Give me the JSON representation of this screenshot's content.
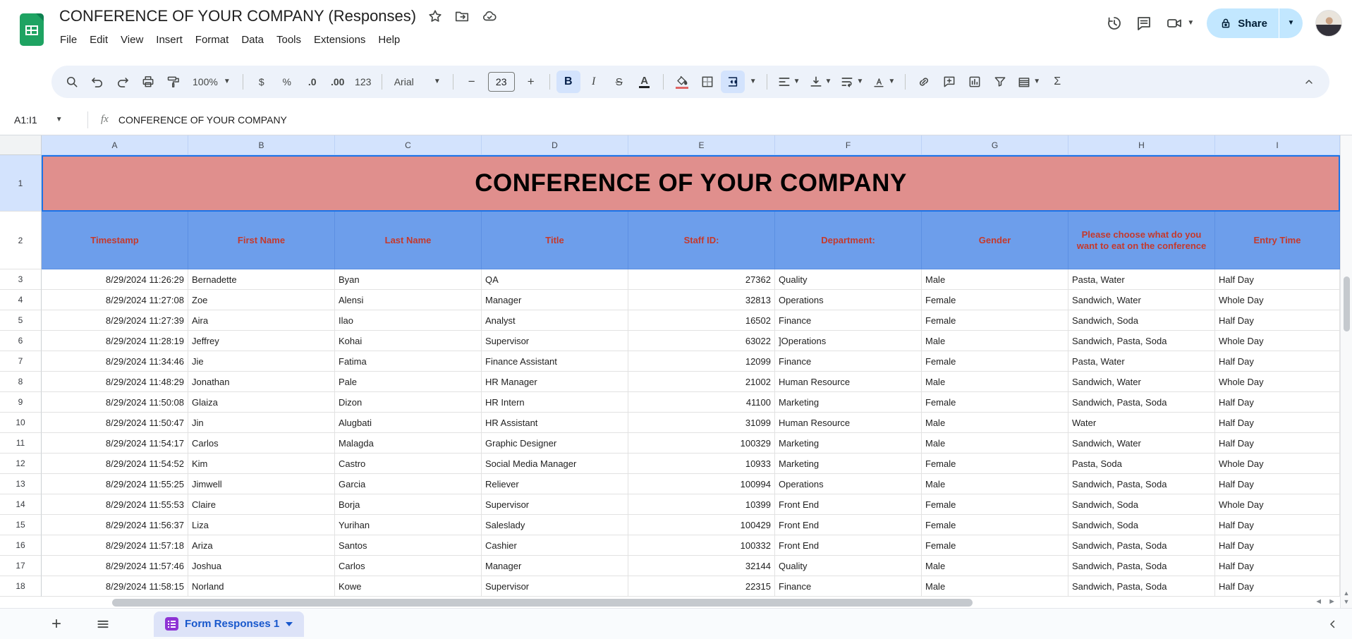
{
  "app": {
    "title": "CONFERENCE OF YOUR COMPANY (Responses)",
    "menus": [
      "File",
      "Edit",
      "View",
      "Insert",
      "Format",
      "Data",
      "Tools",
      "Extensions",
      "Help"
    ],
    "share_label": "Share"
  },
  "toolbar": {
    "zoom_value": "100%",
    "currency": "$",
    "percent": "%",
    "decrease_decimal": ".0",
    "increase_decimal": ".00",
    "more_formats": "123",
    "font_family": "Arial",
    "font_size": "23",
    "minus": "−",
    "plus": "+",
    "bold": "B",
    "italic": "I",
    "strikethrough": "S",
    "text_color": "A",
    "functions": "Σ"
  },
  "formula_bar": {
    "name_box": "A1:I1",
    "fx_label": "fx",
    "value": "CONFERENCE OF YOUR COMPANY"
  },
  "grid": {
    "column_letters": [
      "A",
      "B",
      "C",
      "D",
      "E",
      "F",
      "G",
      "H",
      "I"
    ],
    "title_row": {
      "number": "1",
      "text": "CONFERENCE OF YOUR COMPANY"
    },
    "header_row": {
      "number": "2",
      "cells": [
        "Timestamp",
        "First Name",
        "Last Name",
        "Title",
        "Staff ID:",
        "Department:",
        "Gender",
        "Please choose what do you want to eat on the conference",
        "Entry Time"
      ]
    },
    "rows": [
      {
        "number": "3",
        "cells": [
          "8/29/2024 11:26:29",
          "Bernadette",
          "Byan",
          "QA",
          "27362",
          "Quality",
          "Male",
          "Pasta, Water",
          "Half Day"
        ]
      },
      {
        "number": "4",
        "cells": [
          "8/29/2024 11:27:08",
          "Zoe",
          "Alensi",
          "Manager",
          "32813",
          "Operations",
          "Female",
          "Sandwich, Water",
          "Whole Day"
        ]
      },
      {
        "number": "5",
        "cells": [
          "8/29/2024 11:27:39",
          "Aira",
          "Ilao",
          "Analyst",
          "16502",
          "Finance",
          "Female",
          "Sandwich, Soda",
          "Half Day"
        ]
      },
      {
        "number": "6",
        "cells": [
          "8/29/2024 11:28:19",
          "Jeffrey",
          "Kohai",
          "Supervisor",
          "63022",
          "]Operations",
          "Male",
          "Sandwich, Pasta, Soda",
          "Whole Day"
        ]
      },
      {
        "number": "7",
        "cells": [
          "8/29/2024 11:34:46",
          "Jie",
          "Fatima",
          "Finance Assistant",
          "12099",
          "Finance",
          "Female",
          "Pasta, Water",
          "Half Day"
        ]
      },
      {
        "number": "8",
        "cells": [
          "8/29/2024 11:48:29",
          "Jonathan",
          "Pale",
          "HR Manager",
          "21002",
          "Human Resource",
          "Male",
          "Sandwich, Water",
          "Whole Day"
        ]
      },
      {
        "number": "9",
        "cells": [
          "8/29/2024 11:50:08",
          "Glaiza",
          "Dizon",
          "HR Intern",
          "41100",
          "Marketing",
          "Female",
          "Sandwich, Pasta, Soda",
          "Half Day"
        ]
      },
      {
        "number": "10",
        "cells": [
          "8/29/2024 11:50:47",
          "Jin",
          "Alugbati",
          "HR Assistant",
          "31099",
          "Human Resource",
          "Male",
          "Water",
          "Half Day"
        ]
      },
      {
        "number": "11",
        "cells": [
          "8/29/2024 11:54:17",
          "Carlos",
          "Malagda",
          "Graphic Designer",
          "100329",
          "Marketing",
          "Male",
          "Sandwich, Water",
          "Half Day"
        ]
      },
      {
        "number": "12",
        "cells": [
          "8/29/2024 11:54:52",
          "Kim",
          "Castro",
          "Social Media Manager",
          "10933",
          "Marketing",
          "Female",
          "Pasta, Soda",
          "Whole Day"
        ]
      },
      {
        "number": "13",
        "cells": [
          "8/29/2024 11:55:25",
          "Jimwell",
          "Garcia",
          "Reliever",
          "100994",
          "Operations",
          "Male",
          "Sandwich, Pasta, Soda",
          "Half Day"
        ]
      },
      {
        "number": "14",
        "cells": [
          "8/29/2024 11:55:53",
          "Claire",
          "Borja",
          "Supervisor",
          "10399",
          "Front End",
          "Female",
          "Sandwich, Soda",
          "Whole Day"
        ]
      },
      {
        "number": "15",
        "cells": [
          "8/29/2024 11:56:37",
          "Liza",
          "Yurihan",
          "Saleslady",
          "100429",
          "Front End",
          "Female",
          "Sandwich, Soda",
          "Half Day"
        ]
      },
      {
        "number": "16",
        "cells": [
          "8/29/2024 11:57:18",
          "Ariza",
          "Santos",
          "Cashier",
          "100332",
          "Front End",
          "Female",
          "Sandwich, Pasta, Soda",
          "Half Day"
        ]
      },
      {
        "number": "17",
        "cells": [
          "8/29/2024 11:57:46",
          "Joshua",
          "Carlos",
          "Manager",
          "32144",
          "Quality",
          "Male",
          "Sandwich, Pasta, Soda",
          "Half Day"
        ]
      },
      {
        "number": "18",
        "cells": [
          "8/29/2024 11:58:15",
          "Norland",
          "Kowe",
          "Supervisor",
          "22315",
          "Finance",
          "Male",
          "Sandwich, Pasta, Soda",
          "Half Day"
        ]
      }
    ]
  },
  "sheet_bar": {
    "tab_label": "Form Responses 1"
  },
  "icons": {
    "topbar": [
      "star-icon",
      "move-folder-icon",
      "cloud-saved-icon",
      "version-history-icon",
      "comments-icon",
      "video-call-icon"
    ],
    "toolbar": [
      "search-icon",
      "undo-icon",
      "redo-icon",
      "print-icon",
      "paint-format-icon",
      "fill-color-icon",
      "borders-icon",
      "merge-cells-icon",
      "horizontal-align-icon",
      "vertical-align-icon",
      "text-wrap-icon",
      "text-rotation-icon",
      "insert-link-icon",
      "insert-comment-icon",
      "insert-chart-icon",
      "create-filter-icon",
      "table-views-icon",
      "collapse-toolbar-icon"
    ]
  },
  "colors": {
    "title_row_bg": "#e08f8d",
    "header_row_bg": "#6d9eeb",
    "header_text": "#c5392c",
    "selection_blue": "#1a73e8",
    "selected_head_bg": "#d3e3fd",
    "share_pill_bg": "#c2e7ff",
    "tab_bg": "#dde3f8",
    "tab_text": "#1757cc",
    "forms_purple": "#8e34d4",
    "sheets_green": "#1ea362"
  }
}
